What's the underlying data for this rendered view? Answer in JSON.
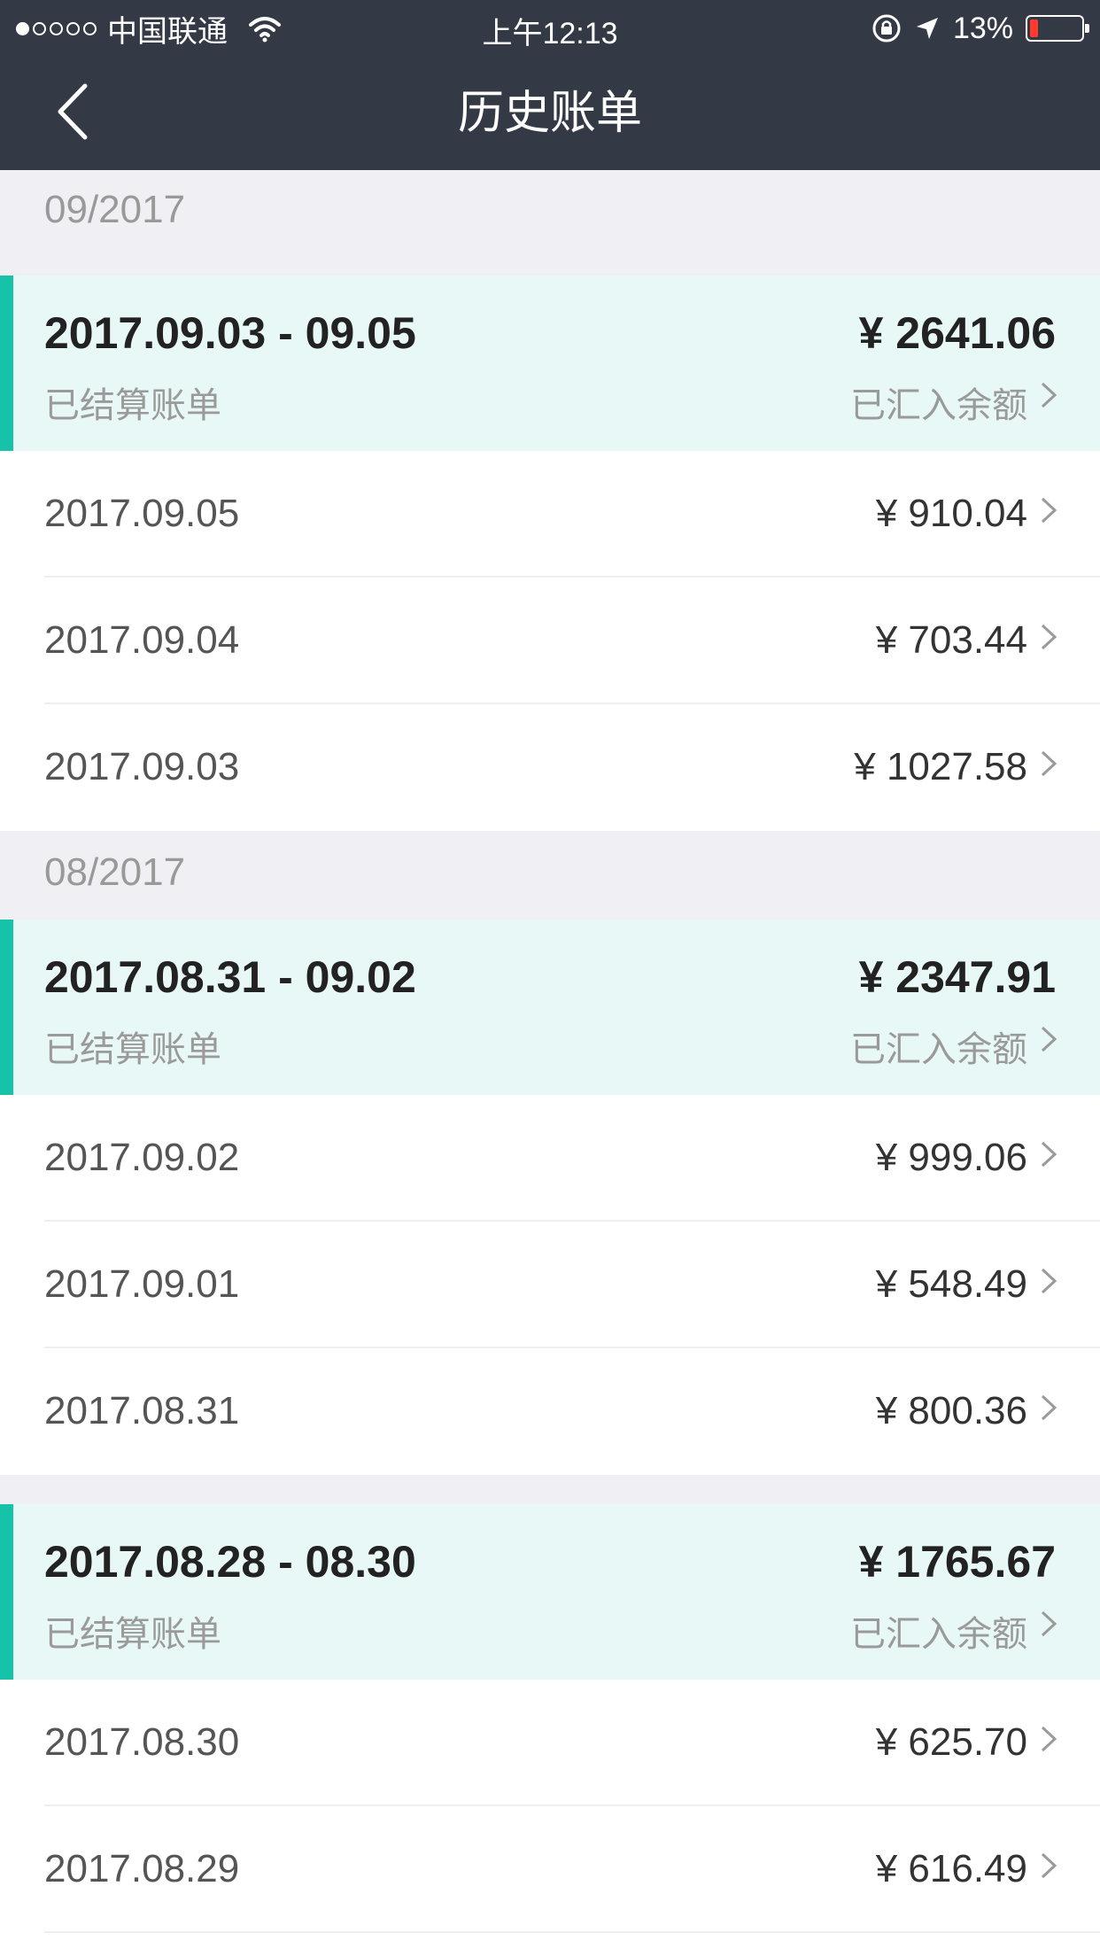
{
  "status_bar": {
    "carrier": "中国联通",
    "time": "上午12:13",
    "battery": "13%",
    "battery_level": 0.13
  },
  "nav": {
    "title": "历史账单",
    "back_icon": "chevron-left-icon"
  },
  "colors": {
    "accent": "#17c3a8",
    "header_bg": "#343a45",
    "summary_bg": "#e7f8f6"
  },
  "sections": [
    {
      "month": "09/2017",
      "summary": {
        "range": "2017.09.03 - 09.05",
        "status": "已结算账单",
        "total": "¥ 2641.06",
        "note": "已汇入余额"
      },
      "days": [
        {
          "date": "2017.09.05",
          "amount": "¥ 910.04"
        },
        {
          "date": "2017.09.04",
          "amount": "¥ 703.44"
        },
        {
          "date": "2017.09.03",
          "amount": "¥ 1027.58"
        }
      ]
    },
    {
      "month": "08/2017",
      "summary": {
        "range": "2017.08.31 - 09.02",
        "status": "已结算账单",
        "total": "¥ 2347.91",
        "note": "已汇入余额"
      },
      "days": [
        {
          "date": "2017.09.02",
          "amount": "¥ 999.06"
        },
        {
          "date": "2017.09.01",
          "amount": "¥ 548.49"
        },
        {
          "date": "2017.08.31",
          "amount": "¥ 800.36"
        }
      ]
    },
    {
      "month": "",
      "summary": {
        "range": "2017.08.28 - 08.30",
        "status": "已结算账单",
        "total": "¥ 1765.67",
        "note": "已汇入余额"
      },
      "days": [
        {
          "date": "2017.08.30",
          "amount": "¥ 625.70"
        },
        {
          "date": "2017.08.29",
          "amount": "¥ 616.49"
        }
      ]
    }
  ]
}
